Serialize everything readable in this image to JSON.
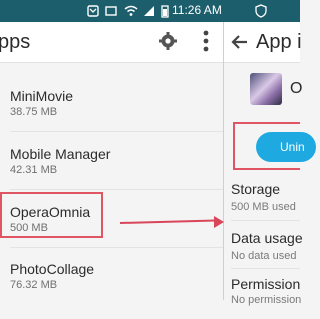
{
  "status_bar": {
    "time": "11:26 AM",
    "icons": [
      "notification-icon",
      "mail-icon",
      "wifi-icon",
      "signal-icon",
      "battery-icon"
    ]
  },
  "left_panel": {
    "title": "pps",
    "items": [
      {
        "name": "MiniMovie",
        "size": "38.75 MB"
      },
      {
        "name": "Mobile Manager",
        "size": "42.31 MB"
      },
      {
        "name": "OperaOmnia",
        "size": "500 MB"
      },
      {
        "name": "PhotoCollage",
        "size": "76.32 MB"
      }
    ]
  },
  "right_panel": {
    "title": "App i",
    "app_name": "O",
    "uninstall_label": "Unin",
    "sections": [
      {
        "title": "Storage",
        "value": "500 MB used"
      },
      {
        "title": "Data usage",
        "value": "No data used"
      },
      {
        "title": "Permission",
        "value": "No permission"
      }
    ]
  },
  "colors": {
    "status_bar": "#1c5e6c",
    "highlight": "#e05564",
    "uninstall": "#1ea9e0"
  }
}
